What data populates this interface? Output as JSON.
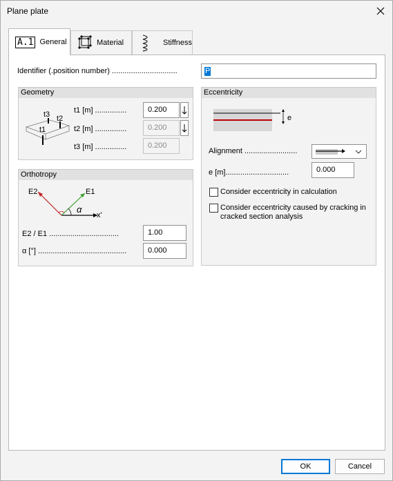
{
  "window": {
    "title": "Plane plate"
  },
  "tabs": [
    {
      "label": "General",
      "icon_text": "A.1",
      "icon": "a1-icon"
    },
    {
      "label": "Material",
      "icon": "material-cube-icon"
    },
    {
      "label": "Stiffness",
      "icon": "spring-icon"
    }
  ],
  "identifier": {
    "label": "Identifier (.position number) ...............................",
    "value": "P"
  },
  "geometry": {
    "title": "Geometry",
    "diagram": {
      "t1": "t1",
      "t2": "t2",
      "t3": "t3"
    },
    "fields": [
      {
        "label": "t1 [m] ...............",
        "value": "0.200"
      },
      {
        "label": "t2 [m] ...............",
        "value": "0.200"
      },
      {
        "label": "t3 [m] ...............",
        "value": "0.200"
      }
    ]
  },
  "orthotropy": {
    "title": "Orthotropy",
    "diagram": {
      "e2": "E2",
      "e1": "E1",
      "alpha": "α",
      "xprime": "x'"
    },
    "fields": [
      {
        "label": "E2 / E1 .................................",
        "value": "1.00"
      },
      {
        "label": "α [°] ..........................................",
        "value": "0.000"
      }
    ]
  },
  "eccentricity": {
    "title": "Eccentricity",
    "diagram": {
      "e": "e"
    },
    "alignment_label": "Alignment .........................",
    "e_label": "e [m]..............................",
    "e_value": "0.000",
    "checkbox1": "Consider eccentricity in calculation",
    "checkbox2_line1": "Consider eccentricity caused by cracking in",
    "checkbox2_line2": "cracked section analysis"
  },
  "buttons": {
    "ok": "OK",
    "cancel": "Cancel"
  },
  "colors": {
    "accent": "#0078d7",
    "red_line": "#c00000",
    "e1_green": "#3a9a2a",
    "e2_red": "#c02020"
  }
}
